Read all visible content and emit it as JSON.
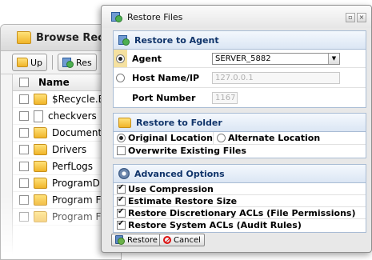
{
  "browse": {
    "title": "Browse Reco",
    "toolbar": {
      "up_label": "Up",
      "restore_label": "Res"
    },
    "columns": {
      "name": "Name"
    },
    "rows": [
      {
        "name": "$Recycle.B",
        "type": "folder"
      },
      {
        "name": "checkvers",
        "type": "file"
      },
      {
        "name": "Document",
        "type": "folder"
      },
      {
        "name": "Drivers",
        "type": "folder"
      },
      {
        "name": "PerfLogs",
        "type": "folder"
      },
      {
        "name": "ProgramD",
        "type": "folder"
      },
      {
        "name": "Program F",
        "type": "folder"
      },
      {
        "name": "Program F",
        "type": "folder"
      }
    ]
  },
  "dialog": {
    "title": "Restore Files",
    "agent_section": {
      "heading": "Restore to Agent",
      "agent_label": "Agent",
      "agent_value": "SERVER_5882",
      "host_label": "Host Name/IP",
      "host_placeholder": "127.0.0.1",
      "port_label": "Port Number",
      "port_placeholder": "1167"
    },
    "folder_section": {
      "heading": "Restore to Folder",
      "original_label": "Original Location",
      "alternate_label": "Alternate Location",
      "overwrite_label": "Overwrite Existing Files"
    },
    "advanced_section": {
      "heading": "Advanced Options",
      "options": [
        {
          "label": "Use Compression",
          "checked": true
        },
        {
          "label": "Estimate Restore Size",
          "checked": true
        },
        {
          "label": "Restore Discretionary ACLs (File Permissions)",
          "checked": true
        },
        {
          "label": "Restore System ACLs (Audit Rules)",
          "checked": true
        }
      ]
    },
    "buttons": {
      "restore": "Restore",
      "cancel": "Cancel"
    }
  },
  "colors": {
    "panel_header_text": "#10346a",
    "panel_border": "#a9bcd4",
    "folder": "#f0b429"
  },
  "icons": [
    "folder-icon",
    "file-icon",
    "up-icon",
    "agent-icon",
    "gear-icon",
    "cancel-icon",
    "restore-icon"
  ]
}
